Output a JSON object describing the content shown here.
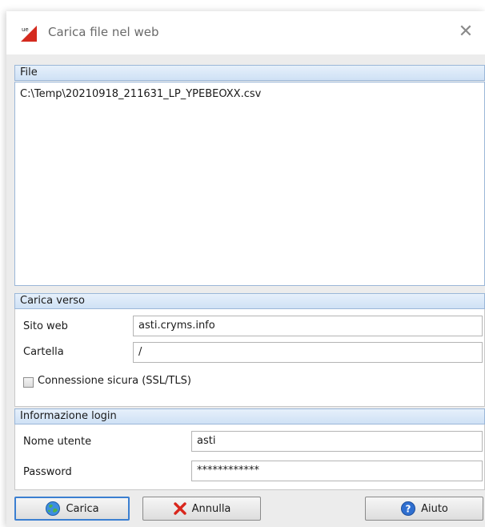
{
  "window": {
    "title": "Carica file nel web",
    "close_icon": "close-icon",
    "app_icon": "app-logo-icon"
  },
  "file_section": {
    "header": "File",
    "files": [
      "C:\\Temp\\20210918_211631_LP_YPEBEOXX.csv"
    ]
  },
  "upload_section": {
    "header": "Carica verso",
    "site_label": "Sito web",
    "site_value": "asti.cryms.info",
    "folder_label": "Cartella",
    "folder_value": "/",
    "secure_label": "Connessione sicura (SSL/TLS)",
    "secure_checked": false
  },
  "login_section": {
    "header": "Informazione login",
    "user_label": "Nome utente",
    "user_value": "asti",
    "password_label": "Password",
    "password_value": "************"
  },
  "buttons": {
    "upload_label": "Carica",
    "upload_icon": "globe-upload-icon",
    "cancel_label": "Annulla",
    "cancel_icon": "red-x-icon",
    "help_label": "Aiuto",
    "help_icon": "help-icon"
  },
  "colors": {
    "accent": "#3b7fd1",
    "header_border": "#9bb7d8",
    "cancel_red": "#d9261c"
  }
}
